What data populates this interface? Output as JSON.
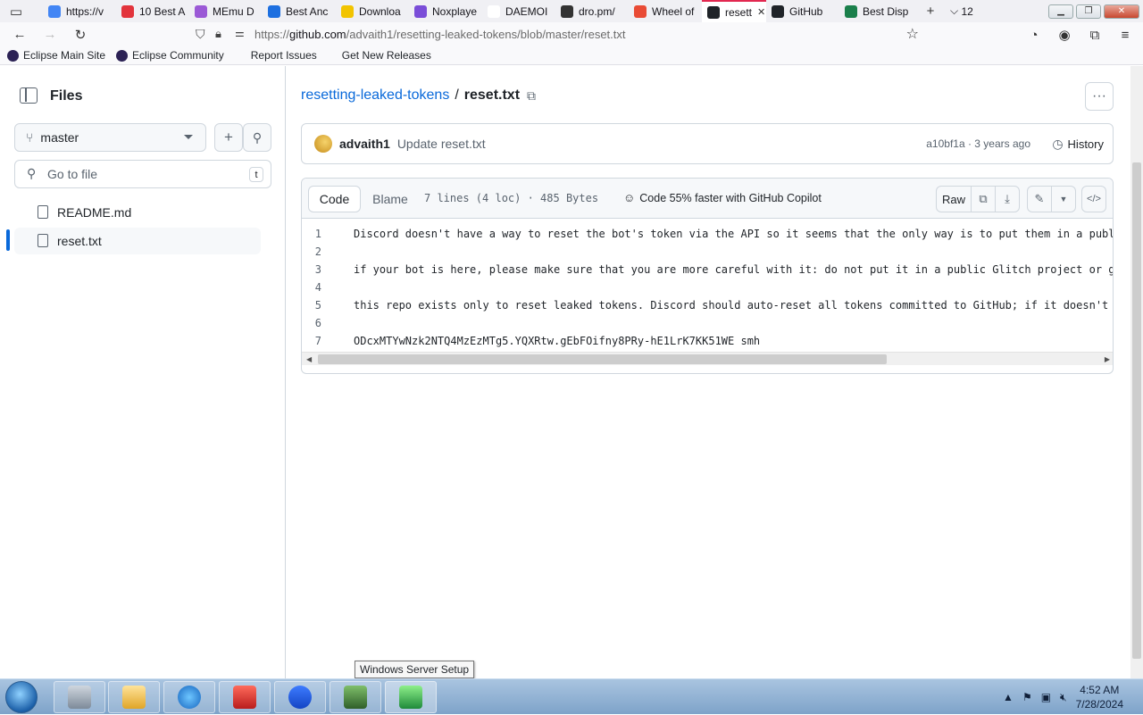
{
  "browser": {
    "tabs": [
      {
        "label": "https://v",
        "color": "#4285f4"
      },
      {
        "label": "10 Best A",
        "color": "#e2343c"
      },
      {
        "label": "MEmu D",
        "color": "#9b59d6"
      },
      {
        "label": "Best Anc",
        "color": "#1d6fe0"
      },
      {
        "label": "Downloa",
        "color": "#f2c400"
      },
      {
        "label": "Noxplaye",
        "color": "#7a4dd8"
      },
      {
        "label": "DAEMOI",
        "color": "#ffffff"
      },
      {
        "label": "dro.pm/",
        "color": "#333333"
      },
      {
        "label": "Wheel of",
        "color": "#e94b35"
      },
      {
        "label": "resett",
        "color": "#1f2328",
        "active": true
      },
      {
        "label": "GitHub",
        "color": "#1f2328"
      },
      {
        "label": "Best Disp",
        "color": "#1a7f4b"
      }
    ],
    "tab_count": "12",
    "url_prefix": "https://",
    "url_host": "github.com",
    "url_path": "/advaith1/resetting-leaked-tokens/blob/master/reset.txt",
    "bookmarks": [
      "Eclipse Main Site",
      "Eclipse Community",
      "Report Issues",
      "Get New Releases"
    ]
  },
  "sidebar": {
    "title": "Files",
    "branch": "master",
    "goto_placeholder": "Go to file",
    "goto_shortcut": "t",
    "files": [
      {
        "name": "README.md"
      },
      {
        "name": "reset.txt",
        "selected": true
      }
    ]
  },
  "main": {
    "repo_link": "resetting-leaked-tokens",
    "separator": "/",
    "filename": "reset.txt",
    "commit": {
      "author": "advaith1",
      "message": "Update reset.txt",
      "meta": "a10bf1a · 3 years ago",
      "history_label": "History"
    },
    "code_header": {
      "tab_code": "Code",
      "tab_blame": "Blame",
      "file_info": "7 lines (4 loc) · 485 Bytes",
      "copilot": "Code 55% faster with GitHub Copilot",
      "raw_label": "Raw"
    },
    "lines": [
      {
        "n": "1",
        "text": "Discord doesn't have a way to reset the bot's token via the API so it seems that the only way is to put them in a public g"
      },
      {
        "n": "2",
        "text": ""
      },
      {
        "n": "3",
        "text": "if your bot is here, please make sure that you are more careful with it: do not put it in a public Glitch project or git r"
      },
      {
        "n": "4",
        "text": ""
      },
      {
        "n": "5",
        "text": "this repo exists only to reset leaked tokens. Discord should auto-reset all tokens committed to GitHub; if it doesn't work"
      },
      {
        "n": "6",
        "text": ""
      },
      {
        "n": "7",
        "text": "ODcxMTYwNzk2NTQ4MzEzMTg5.YQXRtw.gEbFOifny8PRy-hE1LrK7KK51WE smh"
      }
    ]
  },
  "taskbar": {
    "tooltip": "Windows Server Setup",
    "time": "4:52 AM",
    "date": "7/28/2024"
  }
}
